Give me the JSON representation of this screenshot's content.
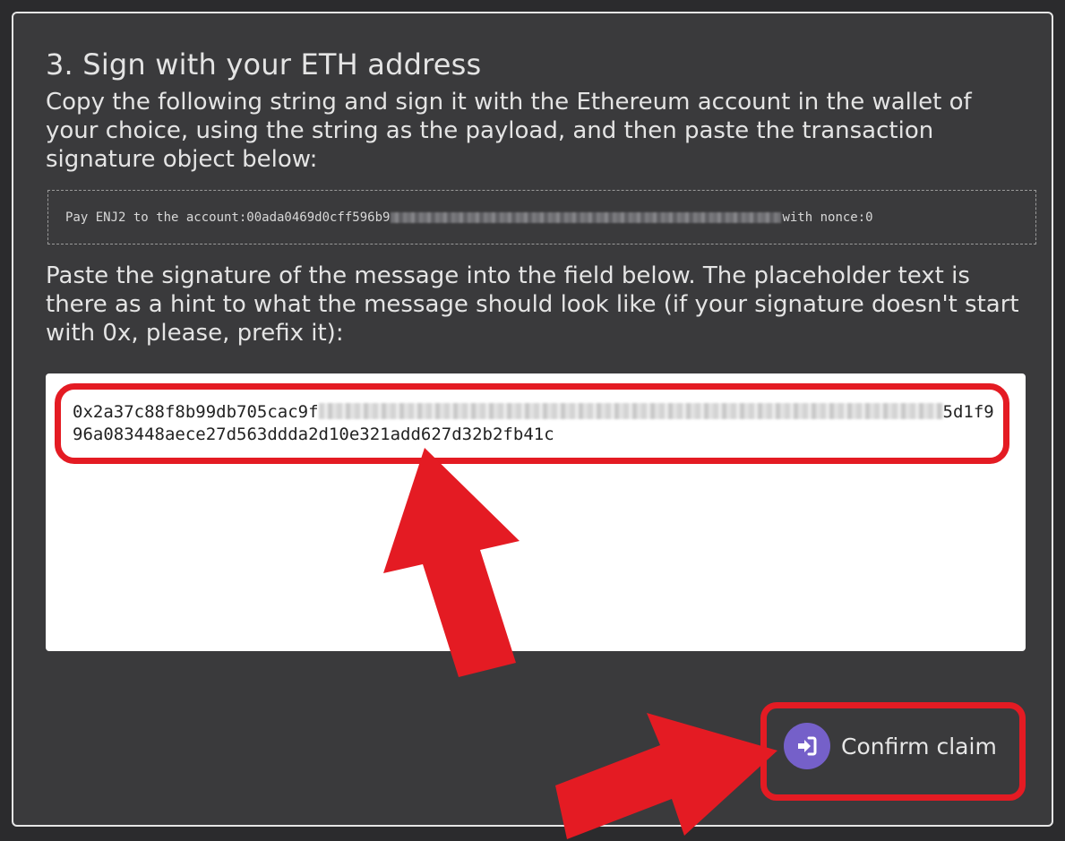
{
  "step": {
    "title": "3. Sign with your ETH address",
    "instructions": "Copy the following string and sign it with the Ethereum account in the wallet of your choice, using the string as the payload, and then paste the transaction signature object below:"
  },
  "message": {
    "prefix": "Pay ENJ2 to the account:00ada0469d0cff596b9",
    "suffix": " with nonce:0"
  },
  "signature_help": "Paste the signature of the message into the field below. The placeholder text is there as a hint to what the message should look like (if your signature doesn't start with 0x, please, prefix it):",
  "signature": {
    "start": "0x2a37c88f8b99db705cac9f",
    "end": "5d1f996a083448aece27d563ddda2d10e321add627d32b2fb41c"
  },
  "button": {
    "label": "Confirm claim",
    "icon": "sign-in-icon"
  },
  "colors": {
    "panel": "#3a3a3c",
    "highlight": "#e41b23",
    "button_icon": "#7560c9"
  }
}
